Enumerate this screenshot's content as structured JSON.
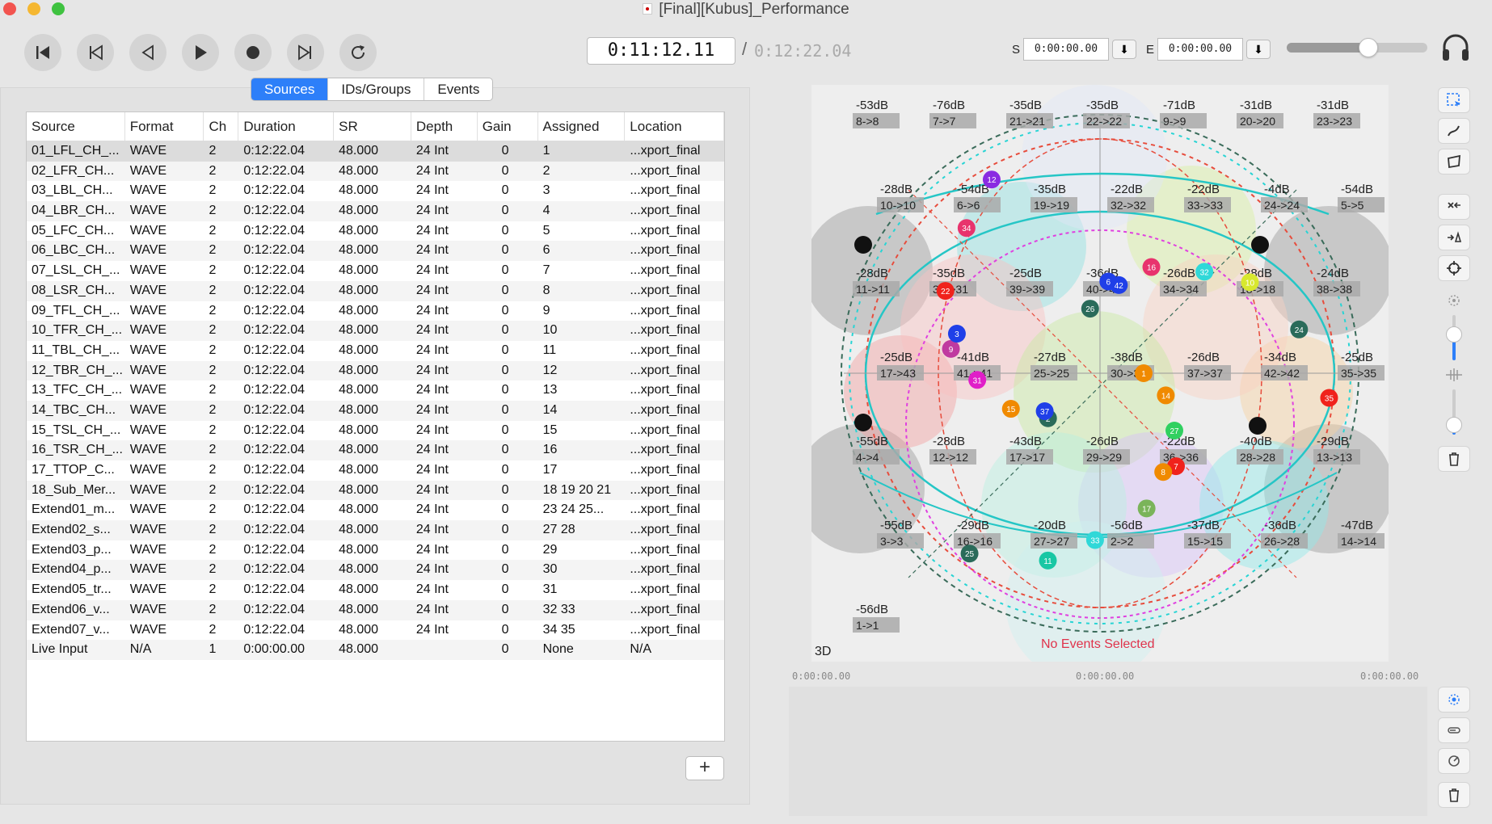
{
  "window": {
    "title": "[Final][Kubus]_Performance"
  },
  "transport": {
    "buttons": [
      "skip-to-start",
      "previous-marker",
      "step-back",
      "play",
      "record",
      "next-marker",
      "loop"
    ],
    "current_time": "0:11:12.11",
    "separator": "/",
    "total_time": "0:12:22.04",
    "start_label": "S",
    "start_value": "0:00:00.00",
    "end_label": "E",
    "end_value": "0:00:00.00",
    "set_button": "⬇",
    "volume_level": 0.58
  },
  "tabs": [
    {
      "label": "Sources",
      "active": true
    },
    {
      "label": "IDs/Groups",
      "active": false
    },
    {
      "label": "Events",
      "active": false
    }
  ],
  "table": {
    "columns": [
      "Source",
      "Format",
      "Ch",
      "Duration",
      "SR",
      "Depth",
      "Gain",
      "Assigned",
      "Location"
    ],
    "rows": [
      [
        "01_LFL_CH_...",
        "WAVE",
        "2",
        "0:12:22.04",
        "48.000",
        "24 Int",
        "0",
        "1",
        "...xport_final"
      ],
      [
        "02_LFR_CH...",
        "WAVE",
        "2",
        "0:12:22.04",
        "48.000",
        "24 Int",
        "0",
        "2",
        "...xport_final"
      ],
      [
        "03_LBL_CH...",
        "WAVE",
        "2",
        "0:12:22.04",
        "48.000",
        "24 Int",
        "0",
        "3",
        "...xport_final"
      ],
      [
        "04_LBR_CH...",
        "WAVE",
        "2",
        "0:12:22.04",
        "48.000",
        "24 Int",
        "0",
        "4",
        "...xport_final"
      ],
      [
        "05_LFC_CH...",
        "WAVE",
        "2",
        "0:12:22.04",
        "48.000",
        "24 Int",
        "0",
        "5",
        "...xport_final"
      ],
      [
        "06_LBC_CH...",
        "WAVE",
        "2",
        "0:12:22.04",
        "48.000",
        "24 Int",
        "0",
        "6",
        "...xport_final"
      ],
      [
        "07_LSL_CH_...",
        "WAVE",
        "2",
        "0:12:22.04",
        "48.000",
        "24 Int",
        "0",
        "7",
        "...xport_final"
      ],
      [
        "08_LSR_CH...",
        "WAVE",
        "2",
        "0:12:22.04",
        "48.000",
        "24 Int",
        "0",
        "8",
        "...xport_final"
      ],
      [
        "09_TFL_CH_...",
        "WAVE",
        "2",
        "0:12:22.04",
        "48.000",
        "24 Int",
        "0",
        "9",
        "...xport_final"
      ],
      [
        "10_TFR_CH_...",
        "WAVE",
        "2",
        "0:12:22.04",
        "48.000",
        "24 Int",
        "0",
        "10",
        "...xport_final"
      ],
      [
        "11_TBL_CH_...",
        "WAVE",
        "2",
        "0:12:22.04",
        "48.000",
        "24 Int",
        "0",
        "11",
        "...xport_final"
      ],
      [
        "12_TBR_CH_...",
        "WAVE",
        "2",
        "0:12:22.04",
        "48.000",
        "24 Int",
        "0",
        "12",
        "...xport_final"
      ],
      [
        "13_TFC_CH_...",
        "WAVE",
        "2",
        "0:12:22.04",
        "48.000",
        "24 Int",
        "0",
        "13",
        "...xport_final"
      ],
      [
        "14_TBC_CH...",
        "WAVE",
        "2",
        "0:12:22.04",
        "48.000",
        "24 Int",
        "0",
        "14",
        "...xport_final"
      ],
      [
        "15_TSL_CH_...",
        "WAVE",
        "2",
        "0:12:22.04",
        "48.000",
        "24 Int",
        "0",
        "15",
        "...xport_final"
      ],
      [
        "16_TSR_CH_...",
        "WAVE",
        "2",
        "0:12:22.04",
        "48.000",
        "24 Int",
        "0",
        "16",
        "...xport_final"
      ],
      [
        "17_TTOP_C...",
        "WAVE",
        "2",
        "0:12:22.04",
        "48.000",
        "24 Int",
        "0",
        "17",
        "...xport_final"
      ],
      [
        "18_Sub_Mer...",
        "WAVE",
        "2",
        "0:12:22.04",
        "48.000",
        "24 Int",
        "0",
        "18 19 20 21",
        "...xport_final"
      ],
      [
        "Extend01_m...",
        "WAVE",
        "2",
        "0:12:22.04",
        "48.000",
        "24 Int",
        "0",
        "23 24 25...",
        "...xport_final"
      ],
      [
        "Extend02_s...",
        "WAVE",
        "2",
        "0:12:22.04",
        "48.000",
        "24 Int",
        "0",
        "27 28",
        "...xport_final"
      ],
      [
        "Extend03_p...",
        "WAVE",
        "2",
        "0:12:22.04",
        "48.000",
        "24 Int",
        "0",
        "29",
        "...xport_final"
      ],
      [
        "Extend04_p...",
        "WAVE",
        "2",
        "0:12:22.04",
        "48.000",
        "24 Int",
        "0",
        "30",
        "...xport_final"
      ],
      [
        "Extend05_tr...",
        "WAVE",
        "2",
        "0:12:22.04",
        "48.000",
        "24 Int",
        "0",
        "31",
        "...xport_final"
      ],
      [
        "Extend06_v...",
        "WAVE",
        "2",
        "0:12:22.04",
        "48.000",
        "24 Int",
        "0",
        "32 33",
        "...xport_final"
      ],
      [
        "Extend07_v...",
        "WAVE",
        "2",
        "0:12:22.04",
        "48.000",
        "24 Int",
        "0",
        "34 35",
        "...xport_final"
      ],
      [
        "Live Input",
        "N/A",
        "1",
        "0:00:00.00",
        "48.000",
        "",
        "0",
        "None",
        "N/A"
      ]
    ],
    "add_label": "+"
  },
  "viz": {
    "view_label": "3D",
    "status": "No Events Selected",
    "speakers": [
      {
        "db": "-53dB",
        "map": "8->8"
      },
      {
        "db": "-76dB",
        "map": "7->7"
      },
      {
        "db": "-35dB",
        "map": "21->21"
      },
      {
        "db": "-35dB",
        "map": "22->22"
      },
      {
        "db": "-71dB",
        "map": "9->9"
      },
      {
        "db": "-31dB",
        "map": "20->20"
      },
      {
        "db": "-31dB",
        "map": "23->23"
      },
      {
        "db": "-28dB",
        "map": "10->10"
      },
      {
        "db": "-54dB",
        "map": "6->6"
      },
      {
        "db": "-35dB",
        "map": "19->19"
      },
      {
        "db": "-22dB",
        "map": "32->32"
      },
      {
        "db": "-22dB",
        "map": "33->33"
      },
      {
        "db": "-4dB",
        "map": "24->24"
      },
      {
        "db": "-54dB",
        "map": "5->5"
      },
      {
        "db": "-28dB",
        "map": "11->11"
      },
      {
        "db": "-35dB",
        "map": "31->31"
      },
      {
        "db": "-25dB",
        "map": "39->39"
      },
      {
        "db": "-36dB",
        "map": "40->40"
      },
      {
        "db": "-26dB",
        "map": "34->34"
      },
      {
        "db": "-28dB",
        "map": "18->18"
      },
      {
        "db": "-24dB",
        "map": "38->38"
      },
      {
        "db": "-25dB",
        "map": "17->43"
      },
      {
        "db": "-41dB",
        "map": "41->41"
      },
      {
        "db": "-27dB",
        "map": "25->25"
      },
      {
        "db": "-38dB",
        "map": "30->30"
      },
      {
        "db": "-26dB",
        "map": "37->37"
      },
      {
        "db": "-34dB",
        "map": "42->42"
      },
      {
        "db": "-25dB",
        "map": "35->35"
      },
      {
        "db": "-55dB",
        "map": "4->4"
      },
      {
        "db": "-28dB",
        "map": "12->12"
      },
      {
        "db": "-43dB",
        "map": "17->17"
      },
      {
        "db": "-26dB",
        "map": "29->29"
      },
      {
        "db": "-22dB",
        "map": "36->36"
      },
      {
        "db": "-40dB",
        "map": "28->28"
      },
      {
        "db": "-29dB",
        "map": "13->13"
      },
      {
        "db": "-55dB",
        "map": "3->3"
      },
      {
        "db": "-29dB",
        "map": "16->16"
      },
      {
        "db": "-20dB",
        "map": "27->27"
      },
      {
        "db": "-56dB",
        "map": "2->2"
      },
      {
        "db": "-37dB",
        "map": "15->15"
      },
      {
        "db": "-36dB",
        "map": "26->28"
      },
      {
        "db": "-47dB",
        "map": "14->14"
      },
      {
        "db": "-56dB",
        "map": "1->1"
      }
    ],
    "sources": [
      {
        "id": "1",
        "color": "#f08a00"
      },
      {
        "id": "2",
        "color": "#2a6b5a"
      },
      {
        "id": "6",
        "color": "#1f3fe8"
      },
      {
        "id": "7",
        "color": "#f0221c"
      },
      {
        "id": "9",
        "color": "#c03aa0"
      },
      {
        "id": "10",
        "color": "#d8e82e"
      },
      {
        "id": "11",
        "color": "#18c7a4"
      },
      {
        "id": "12",
        "color": "#8a2be2"
      },
      {
        "id": "14",
        "color": "#f08a00"
      },
      {
        "id": "15",
        "color": "#f08a00"
      },
      {
        "id": "16",
        "color": "#e8336d"
      },
      {
        "id": "17",
        "color": "#7ab45a"
      },
      {
        "id": "22",
        "color": "#f0221c"
      },
      {
        "id": "24",
        "color": "#2a6b5a"
      },
      {
        "id": "25",
        "color": "#2a6b5a"
      },
      {
        "id": "26",
        "color": "#2a6b5a"
      },
      {
        "id": "27",
        "color": "#30d060"
      },
      {
        "id": "31",
        "color": "#e01ec8"
      },
      {
        "id": "32",
        "color": "#30d8d8"
      },
      {
        "id": "33",
        "color": "#30d8d8"
      },
      {
        "id": "34",
        "color": "#e8336d"
      },
      {
        "id": "35",
        "color": "#f0221c"
      },
      {
        "id": "37",
        "color": "#1f3fe8"
      },
      {
        "id": "42",
        "color": "#1f3fe8"
      },
      {
        "id": "8",
        "color": "#f08a00"
      },
      {
        "id": "3",
        "color": "#1f3fe8"
      }
    ]
  },
  "timeline": {
    "start": "0:00:00.00",
    "mid": "0:00:00.00",
    "end": "0:00:00.00"
  },
  "toolbar_top": [
    "select-icon",
    "draw-path-icon",
    "shape-icon",
    "clear-icon",
    "speaker-add-icon",
    "target-icon"
  ],
  "toolbar_bottom": [
    "timeline-select-icon",
    "timeline-fade-icon",
    "timeline-loop-icon",
    "timeline-trash-icon"
  ]
}
